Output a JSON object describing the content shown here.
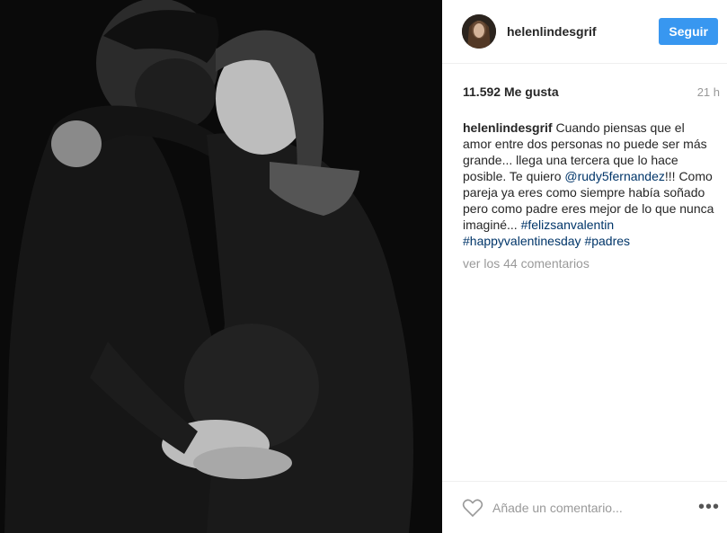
{
  "post": {
    "username": "helenlindesgrif",
    "follow_label": "Seguir",
    "likes": "11.592 Me gusta",
    "time": "21 h",
    "caption_user": "helenlindesgrif",
    "caption_text_1": " Cuando piensas que el amor entre dos personas no puede ser más grande... llega una tercera que lo hace posible. Te quiero ",
    "mention": "@rudy5fernandez",
    "caption_text_2": "!!! Como pareja ya eres como siempre había soñado pero como padre eres mejor de lo que nunca imaginé... ",
    "hashtags": [
      "#felizsanvalentin",
      "#happyvalentinesday",
      "#padres"
    ],
    "view_comments": "ver los 44 comentarios",
    "comment_placeholder": "Añade un comentario...",
    "more_options": "•••"
  },
  "icons": {
    "like": "heart-outline-icon",
    "options": "more-options-icon"
  },
  "colors": {
    "follow_button": "#3897f0",
    "link": "#003569"
  }
}
